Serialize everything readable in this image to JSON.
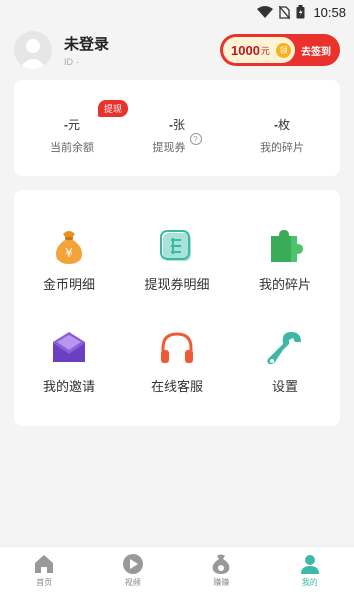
{
  "status_bar": {
    "time": "10:58",
    "icons": [
      "wifi-icon",
      "no-sim-icon",
      "battery-icon"
    ]
  },
  "profile": {
    "name": "未登录",
    "id_label": "ID",
    "id_value": "-"
  },
  "signin": {
    "amount": "1000",
    "unit": "元",
    "coin_label": "领",
    "button_label": "去签到"
  },
  "stats": {
    "badge": "提现",
    "items": [
      {
        "value": "-",
        "unit": "元",
        "label": "当前余额"
      },
      {
        "value": "-",
        "unit": "张",
        "label": "提现券"
      },
      {
        "value": "-",
        "unit": "枚",
        "label": "我的碎片"
      }
    ],
    "help_glyph": "?"
  },
  "menu": {
    "items": [
      {
        "label": "金币明细",
        "icon": "money-bag-icon"
      },
      {
        "label": "提现券明细",
        "icon": "ticket-icon"
      },
      {
        "label": "我的碎片",
        "icon": "puzzle-icon"
      },
      {
        "label": "我的邀请",
        "icon": "envelope-icon"
      },
      {
        "label": "在线客服",
        "icon": "headphones-icon"
      },
      {
        "label": "设置",
        "icon": "wrench-icon"
      }
    ]
  },
  "tabs": [
    {
      "label": "首页",
      "icon": "home-icon",
      "active": false
    },
    {
      "label": "视频",
      "icon": "play-icon",
      "active": false
    },
    {
      "label": "赚赚",
      "icon": "money-bag-icon",
      "active": false
    },
    {
      "label": "我的",
      "icon": "user-icon",
      "active": true
    }
  ],
  "colors": {
    "accent": "#3bb9a6",
    "red": "#e8322b",
    "gold": "#f7b21e"
  }
}
